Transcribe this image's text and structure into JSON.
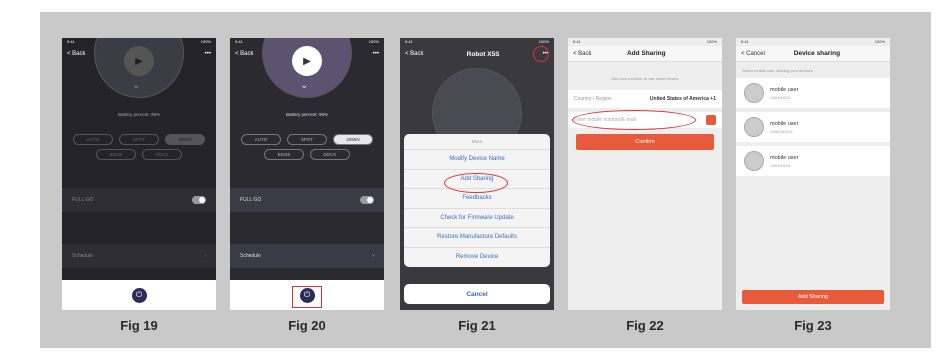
{
  "captions": [
    "Fig 19",
    "Fig 20",
    "Fig 21",
    "Fig 22",
    "Fig 23"
  ],
  "status": {
    "time": "9:41",
    "battery": "100%"
  },
  "robot": {
    "back": "< Back",
    "title": "Robot X5S",
    "more": "•••",
    "battery_text": "Battery percent: 99%",
    "modes": [
      "AUTO",
      "SPOT",
      "20MIN",
      "EDGE",
      "DOCK"
    ],
    "full_go": "FULL GO",
    "schedule": "Schedule",
    "schedule_chevron": "›"
  },
  "sheet": {
    "header": "More",
    "items": [
      "Modify Device Name",
      "Add Sharing",
      "Feedbacks",
      "Check for Firmware Update",
      "Restore Manufacture Defaults",
      "Remove Device"
    ],
    "cancel": "Cancel"
  },
  "add_sharing": {
    "back": "< Back",
    "title": "Add Sharing",
    "hint": "Add new member to use smart device",
    "country_label": "Country / Region",
    "country_value": "United States of America +1",
    "input_placeholder": "Enter mobile number/E-mail",
    "confirm": "Confirm"
  },
  "device_sharing": {
    "cancel": "< Cancel",
    "title": "Device sharing",
    "hint": "Select mobile user sharing your devices",
    "users": [
      {
        "name": "mobile user",
        "sub": "13XXXXXX"
      },
      {
        "name": "mobile user",
        "sub": "139XXXXXX"
      },
      {
        "name": "mobile user",
        "sub": "13XXXXXX"
      }
    ],
    "add_button": "Add Sharing"
  }
}
